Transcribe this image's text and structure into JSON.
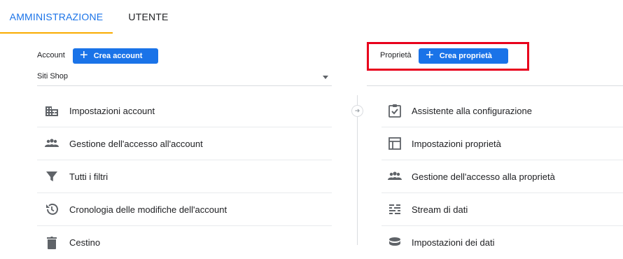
{
  "tabs": [
    {
      "label": "AMMINISTRAZIONE",
      "active": true
    },
    {
      "label": "UTENTE",
      "active": false
    }
  ],
  "account": {
    "label": "Account",
    "create_label": "Crea account",
    "selected": "Siti Shop"
  },
  "property": {
    "label": "Proprietà",
    "create_label": "Crea proprietà"
  },
  "account_menu": [
    {
      "label": "Impostazioni account",
      "icon": "building-icon"
    },
    {
      "label": "Gestione dell'accesso all'account",
      "icon": "people-icon"
    },
    {
      "label": "Tutti i filtri",
      "icon": "filter-icon"
    },
    {
      "label": "Cronologia delle modifiche dell'account",
      "icon": "history-icon"
    },
    {
      "label": "Cestino",
      "icon": "trash-icon"
    }
  ],
  "property_menu": [
    {
      "label": "Assistente alla configurazione",
      "icon": "checklist-icon"
    },
    {
      "label": "Impostazioni proprietà",
      "icon": "layout-icon"
    },
    {
      "label": "Gestione dell'accesso alla proprietà",
      "icon": "people-icon"
    },
    {
      "label": "Stream di dati",
      "icon": "streams-icon"
    },
    {
      "label": "Impostazioni dei dati",
      "icon": "database-icon"
    }
  ],
  "colors": {
    "accent": "#1a73e8",
    "tab_indicator": "#f9ab00",
    "highlight": "#e8001c",
    "icon": "#5f6368"
  }
}
